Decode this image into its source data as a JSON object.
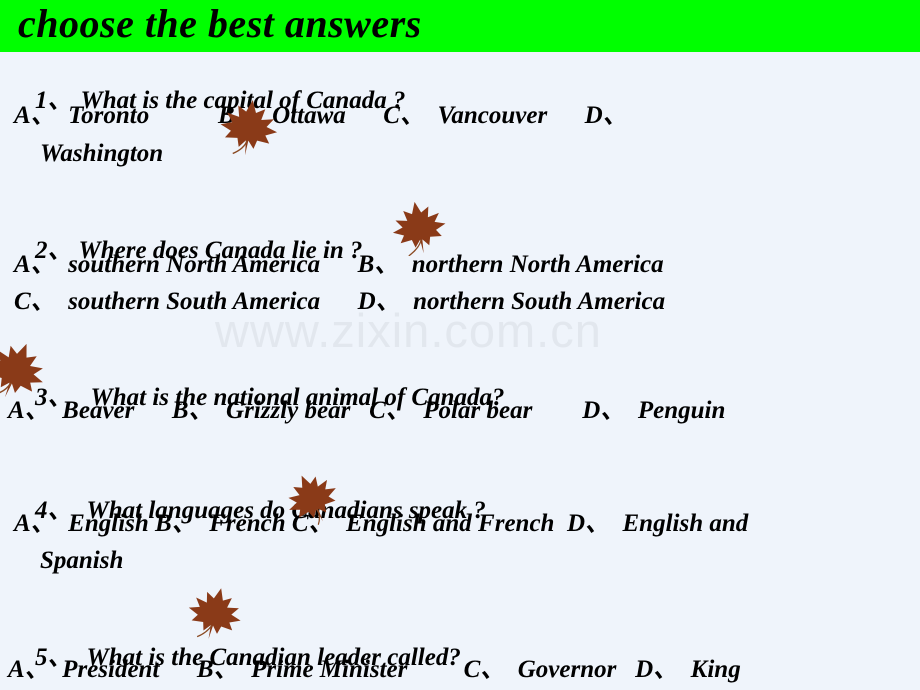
{
  "slide": {
    "title": "choose the best answers",
    "title_bg_color": "#00ff00",
    "background_color": "#eff4fb",
    "text_color": "#000000",
    "leaf_color": "#8a3a18",
    "watermark": "www.zixin.com.cn",
    "watermark_color": "#e2e7ee"
  },
  "questions": [
    {
      "number": "1、",
      "prompt": "What is the capital of Canada ?",
      "answers_line1": "A、  Toronto           B、  Ottawa      C、  Vancouver      D、",
      "answers_line2": "Washington",
      "options": [
        "A、  Toronto",
        "B、  Ottawa",
        "C、  Vancouver",
        "D、  Washington"
      ]
    },
    {
      "number": "2、",
      "prompt": "Where does Canada lie in ?",
      "answers_line1": "A、  southern North America      B、  northern North America",
      "answers_line2": "C、  southern South America      D、  northern South America",
      "options": [
        "A、  southern North America",
        "B、  northern North America",
        "C、  southern South America",
        "D、  northern South America"
      ]
    },
    {
      "number": "3、",
      "prompt": "What is the national animal of Canada?",
      "answers_line1": "A、  Beaver      B、  Grizzly bear   C、  Polar bear        D、  Penguin",
      "answers_line2": "",
      "options": [
        "A、  Beaver",
        "B、  Grizzly bear",
        "C、  Polar bear",
        "D、  Penguin"
      ]
    },
    {
      "number": "4、",
      "prompt": "What languages do Canadians speak ?",
      "answers_line1": "A、  English B、  French C、  English and French  D、  English and",
      "answers_line2": "Spanish",
      "options": [
        "A、  English",
        "B、  French",
        "C、  English and French",
        "D、  English and Spanish"
      ]
    },
    {
      "number": "5、",
      "prompt": "What is the Canadian leader called?",
      "answers_line1": "A、  President      B、  Prime Minister         C、  Governor   D、  King",
      "answers_line2": "",
      "options": [
        "A、  President",
        "B、  Prime Minister",
        "C、  Governor",
        "D、  King"
      ]
    }
  ],
  "decorations": [
    {
      "name": "maple-leaf-1",
      "label": "maple-leaf-icon"
    },
    {
      "name": "maple-leaf-2",
      "label": "maple-leaf-icon"
    },
    {
      "name": "maple-leaf-3",
      "label": "maple-leaf-icon"
    },
    {
      "name": "maple-leaf-4",
      "label": "maple-leaf-icon"
    },
    {
      "name": "maple-leaf-5",
      "label": "maple-leaf-icon"
    }
  ]
}
